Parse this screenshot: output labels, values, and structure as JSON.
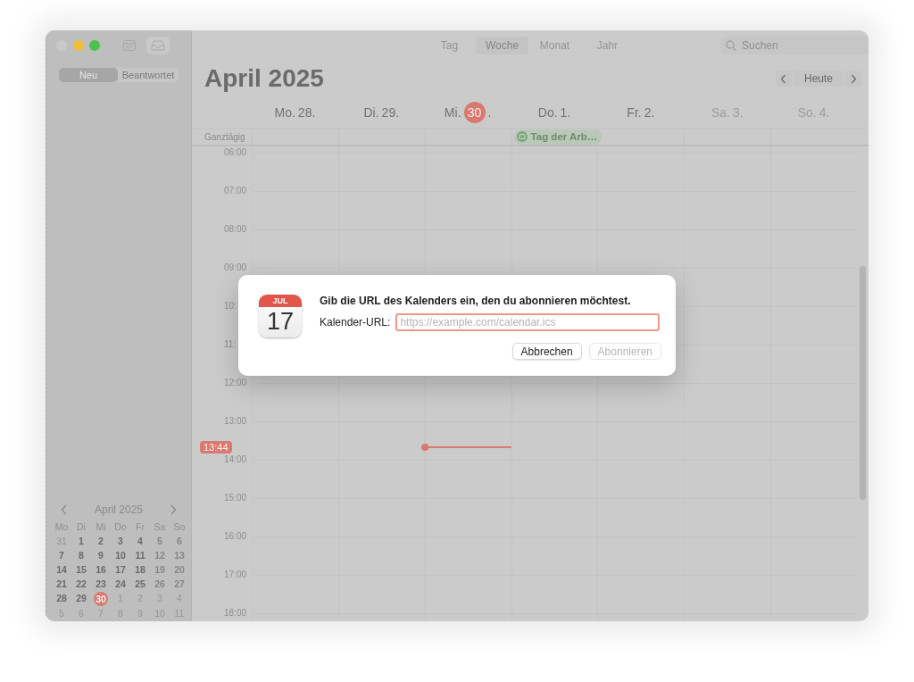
{
  "sidebar": {
    "segments": [
      {
        "label": "Neu",
        "selected": true
      },
      {
        "label": "Beantwortet",
        "selected": false
      }
    ],
    "mini_calendar": {
      "month": "April 2025",
      "weekdays": [
        "Mo",
        "Di",
        "Mi",
        "Do",
        "Fr",
        "Sa",
        "So"
      ],
      "weeks": [
        [
          {
            "label": "31",
            "in_month": false,
            "today": false
          },
          {
            "label": "1",
            "in_month": true,
            "today": false
          },
          {
            "label": "2",
            "in_month": true,
            "today": false
          },
          {
            "label": "3",
            "in_month": true,
            "today": false
          },
          {
            "label": "4",
            "in_month": true,
            "today": false
          },
          {
            "label": "5",
            "in_month": true,
            "today": false
          },
          {
            "label": "6",
            "in_month": true,
            "today": false
          }
        ],
        [
          {
            "label": "7",
            "in_month": true,
            "today": false
          },
          {
            "label": "8",
            "in_month": true,
            "today": false
          },
          {
            "label": "9",
            "in_month": true,
            "today": false
          },
          {
            "label": "10",
            "in_month": true,
            "today": false
          },
          {
            "label": "11",
            "in_month": true,
            "today": false
          },
          {
            "label": "12",
            "in_month": true,
            "today": false
          },
          {
            "label": "13",
            "in_month": true,
            "today": false
          }
        ],
        [
          {
            "label": "14",
            "in_month": true,
            "today": false
          },
          {
            "label": "15",
            "in_month": true,
            "today": false
          },
          {
            "label": "16",
            "in_month": true,
            "today": false
          },
          {
            "label": "17",
            "in_month": true,
            "today": false
          },
          {
            "label": "18",
            "in_month": true,
            "today": false
          },
          {
            "label": "19",
            "in_month": true,
            "today": false
          },
          {
            "label": "20",
            "in_month": true,
            "today": false
          }
        ],
        [
          {
            "label": "21",
            "in_month": true,
            "today": false
          },
          {
            "label": "22",
            "in_month": true,
            "today": false
          },
          {
            "label": "23",
            "in_month": true,
            "today": false
          },
          {
            "label": "24",
            "in_month": true,
            "today": false
          },
          {
            "label": "25",
            "in_month": true,
            "today": false
          },
          {
            "label": "26",
            "in_month": true,
            "today": false
          },
          {
            "label": "27",
            "in_month": true,
            "today": false
          }
        ],
        [
          {
            "label": "28",
            "in_month": true,
            "today": false
          },
          {
            "label": "29",
            "in_month": true,
            "today": false
          },
          {
            "label": "30",
            "in_month": true,
            "today": true
          },
          {
            "label": "1",
            "in_month": false,
            "today": false
          },
          {
            "label": "2",
            "in_month": false,
            "today": false
          },
          {
            "label": "3",
            "in_month": false,
            "today": false
          },
          {
            "label": "4",
            "in_month": false,
            "today": false
          }
        ],
        [
          {
            "label": "5",
            "in_month": false,
            "today": false
          },
          {
            "label": "6",
            "in_month": false,
            "today": false
          },
          {
            "label": "7",
            "in_month": false,
            "today": false
          },
          {
            "label": "8",
            "in_month": false,
            "today": false
          },
          {
            "label": "9",
            "in_month": false,
            "today": false
          },
          {
            "label": "10",
            "in_month": false,
            "today": false
          },
          {
            "label": "11",
            "in_month": false,
            "today": false
          }
        ]
      ]
    }
  },
  "toolbar": {
    "views": [
      {
        "label": "Tag",
        "selected": false
      },
      {
        "label": "Woche",
        "selected": true
      },
      {
        "label": "Monat",
        "selected": false
      },
      {
        "label": "Jahr",
        "selected": false
      }
    ],
    "search": {
      "placeholder": "Suchen"
    }
  },
  "title": "April 2025",
  "today_button": "Heute",
  "days": [
    {
      "weekday": "Mo.",
      "date": "28.",
      "today": false,
      "dimmed": false,
      "now_line": false
    },
    {
      "weekday": "Di.",
      "date": "29.",
      "today": false,
      "dimmed": false,
      "now_line": false
    },
    {
      "weekday": "Mi.",
      "date": "30",
      "after": ".",
      "today": true,
      "dimmed": false,
      "now_line": true
    },
    {
      "weekday": "Do.",
      "date": "1.",
      "today": false,
      "dimmed": false,
      "now_line": false,
      "all_day_event": "Tag der Arb…"
    },
    {
      "weekday": "Fr.",
      "date": "2.",
      "today": false,
      "dimmed": false,
      "now_line": false
    },
    {
      "weekday": "Sa.",
      "date": "3.",
      "today": false,
      "dimmed": true,
      "now_line": false
    },
    {
      "weekday": "So.",
      "date": "4.",
      "today": false,
      "dimmed": true,
      "now_line": false
    }
  ],
  "all_day": {
    "label": "Ganztägig"
  },
  "hours": [
    "06:00",
    "07:00",
    "08:00",
    "09:00",
    "10:",
    "11:",
    "12:00",
    "13:00",
    "14:00",
    "15:00",
    "16:00",
    "17:00",
    "18:00"
  ],
  "now": {
    "label": "13:44"
  },
  "dialog": {
    "icon_month": "JUL",
    "icon_day": "17",
    "message": "Gib die URL des Kalenders ein, den du abonnieren möchtest.",
    "field_label": "Kalender-URL:",
    "placeholder": "https://example.com/calendar.ics",
    "buttons": [
      {
        "label": "Abbrechen",
        "disabled": false
      },
      {
        "label": "Abonnieren",
        "disabled": true
      }
    ]
  }
}
